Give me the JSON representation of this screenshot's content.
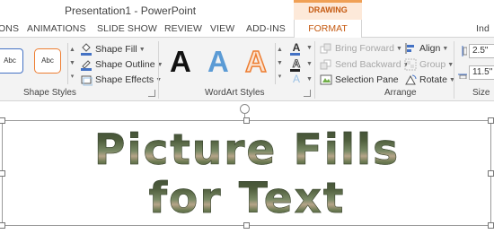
{
  "window": {
    "title": "Presentation1 - PowerPoint"
  },
  "context_tab_group": {
    "label": "DRAWING TOOLS",
    "color": "#c55a11",
    "band_color": "#f0a055"
  },
  "tabs": [
    {
      "label": "ONS"
    },
    {
      "label": "ANIMATIONS"
    },
    {
      "label": "SLIDE SHOW"
    },
    {
      "label": "REVIEW"
    },
    {
      "label": "VIEW"
    },
    {
      "label": "ADD-INS"
    },
    {
      "label": "FORMAT",
      "active": true
    },
    {
      "label": "Ind"
    }
  ],
  "ribbon": {
    "shape_styles": {
      "label": "Shape Styles",
      "thumbs": [
        {
          "text": "Abc"
        },
        {
          "text": "Abc"
        }
      ],
      "commands": [
        {
          "label": "Shape Fill",
          "icon": "paint-bucket-icon"
        },
        {
          "label": "Shape Outline",
          "icon": "pencil-outline-icon"
        },
        {
          "label": "Shape Effects",
          "icon": "shape-effects-icon"
        }
      ]
    },
    "wordart_styles": {
      "label": "WordArt Styles",
      "samples": [
        {
          "text": "A",
          "style": "solid-black",
          "color": "#111111"
        },
        {
          "text": "A",
          "style": "gradient-blue",
          "color": "#5b9bd5"
        },
        {
          "text": "A",
          "style": "outline-orange",
          "color": "#ed7d31"
        }
      ],
      "text_fill_color": "#4472c4",
      "text_outline_color": "#222222",
      "text_effects_color": "#4472c4",
      "glyph": "A"
    },
    "arrange": {
      "label": "Arrange",
      "commands_left": [
        {
          "label": "Bring Forward",
          "icon": "bring-forward-icon",
          "disabled": true
        },
        {
          "label": "Send Backward",
          "icon": "send-backward-icon",
          "disabled": true
        },
        {
          "label": "Selection Pane",
          "icon": "selection-pane-icon",
          "disabled": false
        }
      ],
      "commands_right": [
        {
          "label": "Align",
          "icon": "align-icon",
          "disabled": false
        },
        {
          "label": "Group",
          "icon": "group-icon",
          "disabled": true
        },
        {
          "label": "Rotate",
          "icon": "rotate-icon",
          "disabled": false
        }
      ]
    },
    "size": {
      "label": "Size",
      "height_value": "2.5\"",
      "width_value": "11.5\""
    }
  },
  "slide": {
    "wordart_line1": "Picture Fills",
    "wordart_line2": "for Text"
  }
}
